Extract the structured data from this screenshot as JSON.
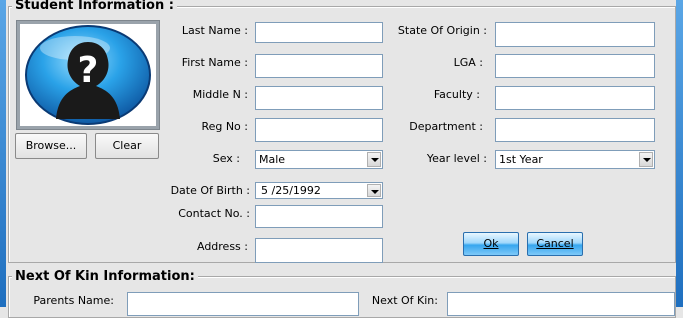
{
  "student_section": {
    "title": "Student Information :"
  },
  "next_of_kin_section": {
    "title": "Next Of Kin Information:"
  },
  "photo": {
    "alt": "placeholder avatar"
  },
  "buttons": {
    "browse": "Browse...",
    "clear": "Clear",
    "ok": "Ok",
    "cancel": "Cancel"
  },
  "fields_left": {
    "last_name": {
      "label": "Last Name :",
      "value": ""
    },
    "first_name": {
      "label": "First Name :",
      "value": ""
    },
    "middle_n": {
      "label": "Middle N :",
      "value": ""
    },
    "reg_no": {
      "label": "Reg No :",
      "value": ""
    },
    "sex": {
      "label": "Sex :",
      "value": "Male"
    },
    "dob": {
      "label": "Date Of Birth :",
      "value": "5 /25/1992"
    },
    "contact": {
      "label": "Contact No. :",
      "value": ""
    },
    "address": {
      "label": "Address :",
      "value": ""
    }
  },
  "fields_right": {
    "state": {
      "label": "State Of Origin :",
      "value": ""
    },
    "lga": {
      "label": "LGA :",
      "value": ""
    },
    "faculty": {
      "label": "Faculty :",
      "value": ""
    },
    "department": {
      "label": "Department :",
      "value": ""
    },
    "year_level": {
      "label": "Year level :",
      "value": "1st Year"
    }
  },
  "next_of_kin": {
    "parents_name": {
      "label": "Parents Name:",
      "value": ""
    },
    "next_of_kin": {
      "label": "Next Of Kin:",
      "value": ""
    }
  },
  "colors": {
    "background": "#e6e6e6",
    "accent": "#36a6ef",
    "border": "#7f9db9"
  },
  "icons": {
    "avatar": "unknown-user-icon",
    "dropdown": "chevron-down-icon"
  }
}
